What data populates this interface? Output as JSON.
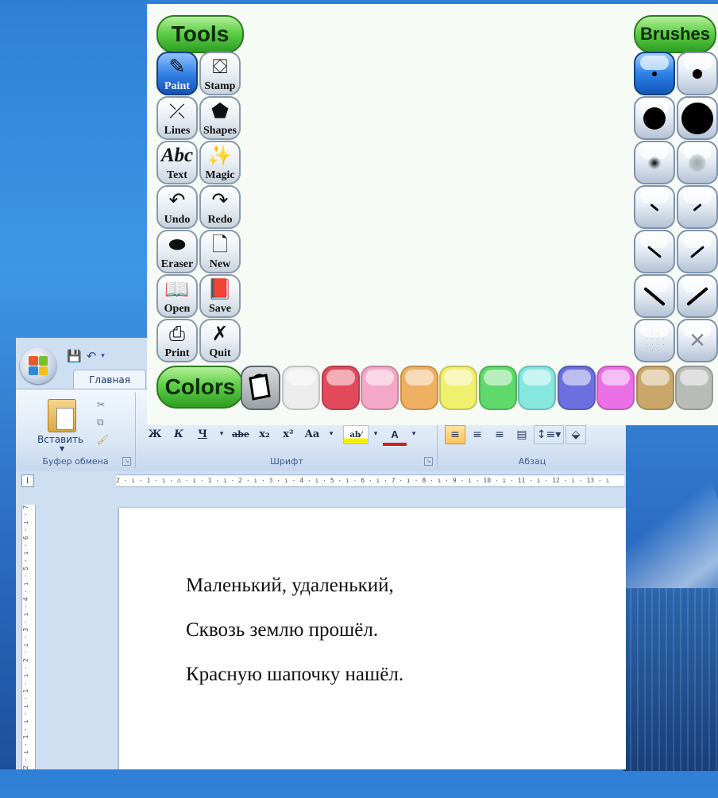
{
  "paint": {
    "tools_header": "Tools",
    "brushes_header": "Brushes",
    "colors_header": "Colors",
    "tools": [
      {
        "label": "Paint",
        "icon": "paint-brush-icon",
        "glyph": "✎",
        "selected": true
      },
      {
        "label": "Stamp",
        "icon": "stamp-icon",
        "glyph": "⛋",
        "selected": false
      },
      {
        "label": "Lines",
        "icon": "lines-icon",
        "glyph": "⤫",
        "selected": false
      },
      {
        "label": "Shapes",
        "icon": "shapes-icon",
        "glyph": "⬟",
        "selected": false
      },
      {
        "label": "Text",
        "icon": "text-icon",
        "glyph": "Abc",
        "selected": false
      },
      {
        "label": "Magic",
        "icon": "magic-wand-icon",
        "glyph": "✨",
        "selected": false
      },
      {
        "label": "Undo",
        "icon": "undo-icon",
        "glyph": "↶",
        "selected": false
      },
      {
        "label": "Redo",
        "icon": "redo-icon",
        "glyph": "↷",
        "selected": false
      },
      {
        "label": "Eraser",
        "icon": "eraser-icon",
        "glyph": "⬬",
        "selected": false
      },
      {
        "label": "New",
        "icon": "new-page-icon",
        "glyph": "🗋",
        "selected": false
      },
      {
        "label": "Open",
        "icon": "open-book-icon",
        "glyph": "📖",
        "selected": false
      },
      {
        "label": "Save",
        "icon": "save-book-icon",
        "glyph": "📕",
        "selected": false
      },
      {
        "label": "Print",
        "icon": "printer-icon",
        "glyph": "⎙",
        "selected": false
      },
      {
        "label": "Quit",
        "icon": "quit-x-icon",
        "glyph": "✗",
        "selected": false
      }
    ],
    "brushes": [
      {
        "type": "dot",
        "size": 6,
        "selected": true
      },
      {
        "type": "dot",
        "size": 12
      },
      {
        "type": "dot",
        "size": 28
      },
      {
        "type": "dot",
        "size": 40
      },
      {
        "type": "soft",
        "size": 10
      },
      {
        "type": "soft-light",
        "size": 14
      },
      {
        "type": "slash-back",
        "size": 8
      },
      {
        "type": "slash-fwd",
        "size": 8
      },
      {
        "type": "slash-back",
        "size": 14
      },
      {
        "type": "slash-fwd",
        "size": 14
      },
      {
        "type": "slash-back",
        "size": 22
      },
      {
        "type": "slash-fwd",
        "size": 22
      },
      {
        "type": "spray",
        "size": 14
      },
      {
        "type": "x-thin",
        "size": 14
      }
    ],
    "colors": [
      "#ececec",
      "#e24a5c",
      "#f2a8c6",
      "#f0b062",
      "#eff06e",
      "#5fd96b",
      "#86e6e0",
      "#6b6fe0",
      "#ea70e6",
      "#c9a76a",
      "#b9bbb9"
    ]
  },
  "word": {
    "home_tab": "Главная",
    "paste_label": "Вставить",
    "clipboard_group": "Буфер обмена",
    "font_group": "Шрифт",
    "paragraph_group": "Абзац",
    "format_buttons": [
      "Ж",
      "К",
      "Ч",
      "abe",
      "x₂",
      "x²",
      "Aa"
    ],
    "ruler_h": "2 · ı · 1 · ı · ⌂ · ı · 1 · ı · 2 · ı · 3 · ı · 4 · ı · 5 · ı · 6 · ı · 7 · ı · 8 · ı · 9 · ı · 10 · ı · 11 · ı · 12 · ı · 13 · ı",
    "ruler_v": "2 · ı · 1 · ı · ı · 1 · ı · 2 · ı · 3 · ı · 4 · ı · 5 · ı · 6 · ı · 7",
    "document_lines": [
      "Маленький, удаленький,",
      "Сквозь землю прошёл.",
      "Красную шапочку нашёл."
    ]
  }
}
